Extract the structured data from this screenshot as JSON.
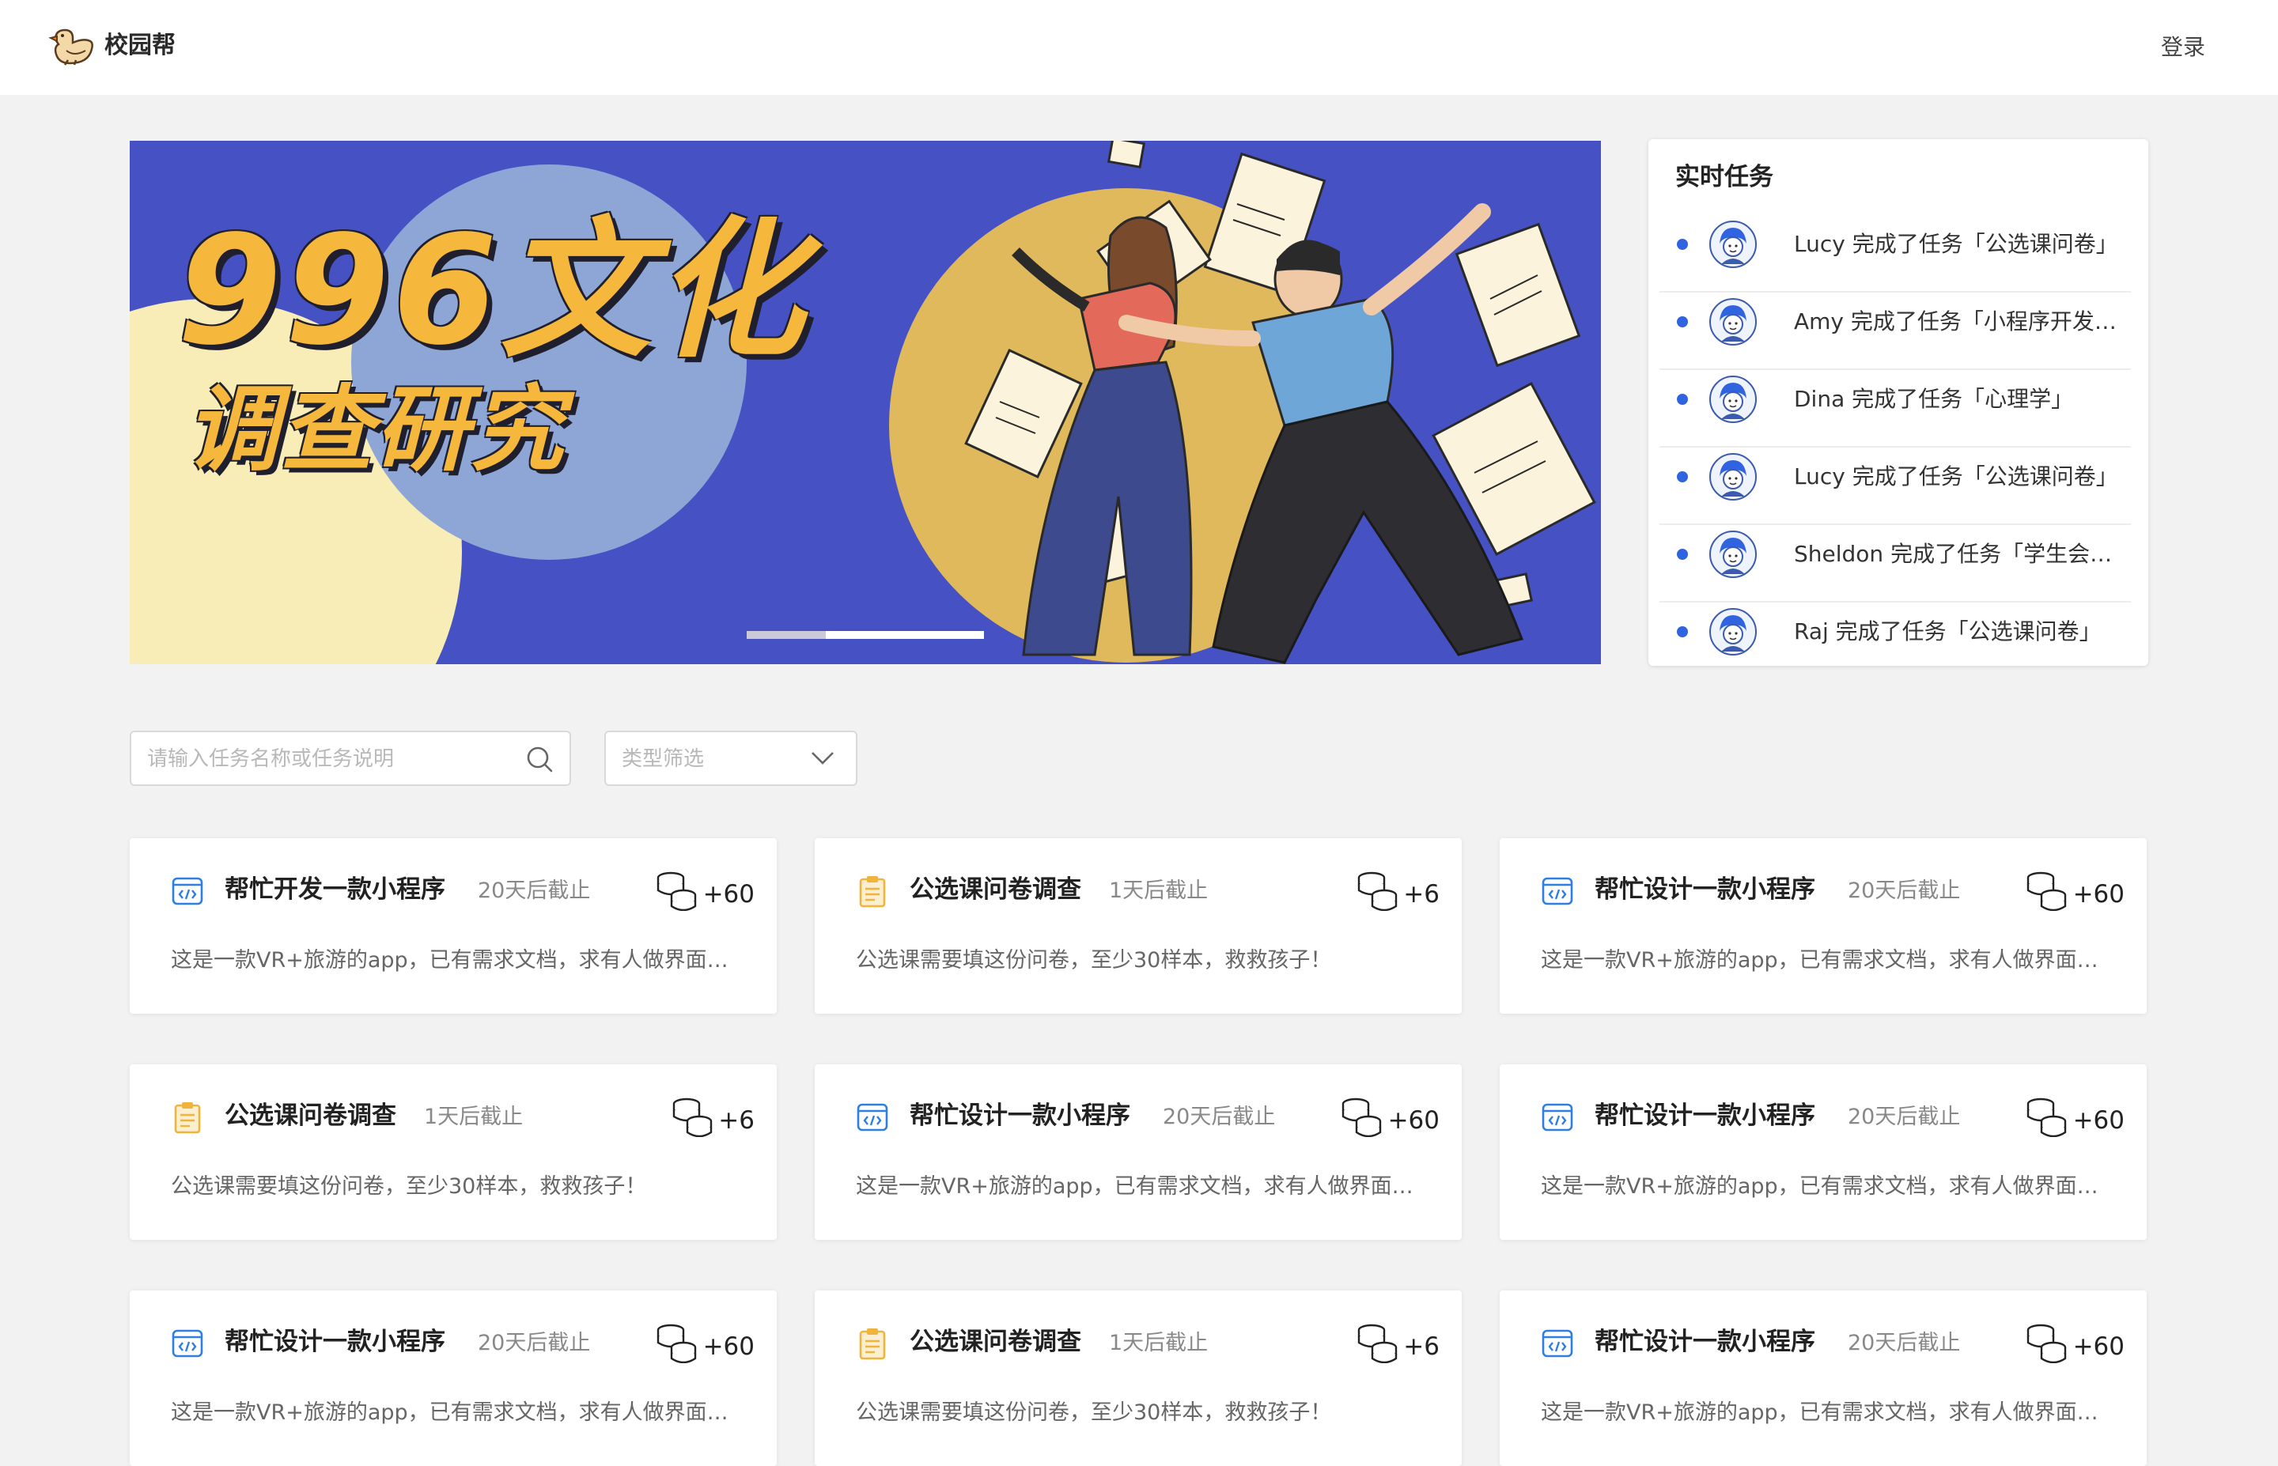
{
  "header": {
    "app_name": "校园帮",
    "login": "登录"
  },
  "banner": {
    "title_line1": "996文化",
    "title_line2": "调查研究",
    "slide_count": 2,
    "active_slide": 2
  },
  "live_tasks": {
    "title": "实时任务",
    "items": [
      {
        "text": "Lucy 完成了任务「公选课问卷」",
        "avatar": "girl-avatar-icon"
      },
      {
        "text": "Amy 完成了任务「小程序开发…",
        "avatar": "bunny-avatar-icon"
      },
      {
        "text": "Dina 完成了任务「心理学」",
        "avatar": "girl-avatar-icon"
      },
      {
        "text": "Lucy 完成了任务「公选课问卷」",
        "avatar": "girl-avatar-icon"
      },
      {
        "text": "Sheldon 完成了任务「学生会…",
        "avatar": "boy-avatar-icon"
      },
      {
        "text": "Raj 完成了任务「公选课问卷」",
        "avatar": "boy-avatar-icon"
      }
    ]
  },
  "filters": {
    "search_placeholder": "请输入任务名称或任务说明",
    "type_select_placeholder": "类型筛选"
  },
  "tasks": [
    {
      "type": "dev",
      "title": "帮忙开发一款小程序",
      "deadline": "20天后截止",
      "reward": "+60",
      "description": "这是一款VR+旅游的app，已有需求文档，求有人做界面…"
    },
    {
      "type": "survey",
      "title": "公选课问卷调查",
      "deadline": "1天后截止",
      "reward": "+6",
      "description": "公选课需要填这份问卷，至少30样本，救救孩子！"
    },
    {
      "type": "dev",
      "title": "帮忙设计一款小程序",
      "deadline": "20天后截止",
      "reward": "+60",
      "description": "这是一款VR+旅游的app，已有需求文档，求有人做界面…"
    },
    {
      "type": "survey",
      "title": "公选课问卷调查",
      "deadline": "1天后截止",
      "reward": "+6",
      "description": "公选课需要填这份问卷，至少30样本，救救孩子！"
    },
    {
      "type": "dev",
      "title": "帮忙设计一款小程序",
      "deadline": "20天后截止",
      "reward": "+60",
      "description": "这是一款VR+旅游的app，已有需求文档，求有人做界面…"
    },
    {
      "type": "dev",
      "title": "帮忙设计一款小程序",
      "deadline": "20天后截止",
      "reward": "+60",
      "description": "这是一款VR+旅游的app，已有需求文档，求有人做界面…"
    },
    {
      "type": "dev",
      "title": "帮忙设计一款小程序",
      "deadline": "20天后截止",
      "reward": "+60",
      "description": "这是一款VR+旅游的app，已有需求文档，求有人做界面…"
    },
    {
      "type": "survey",
      "title": "公选课问卷调查",
      "deadline": "1天后截止",
      "reward": "+6",
      "description": "公选课需要填这份问卷，至少30样本，救救孩子！"
    },
    {
      "type": "dev",
      "title": "帮忙设计一款小程序",
      "deadline": "20天后截止",
      "reward": "+60",
      "description": "这是一款VR+旅游的app，已有需求文档，求有人做界面…"
    }
  ],
  "colors": {
    "accent_blue": "#2f63e0",
    "dev_icon": "#2f7fe0",
    "survey_icon": "#f0b43c",
    "banner_bg": "#4652c4",
    "banner_title": "#f5b83c"
  }
}
